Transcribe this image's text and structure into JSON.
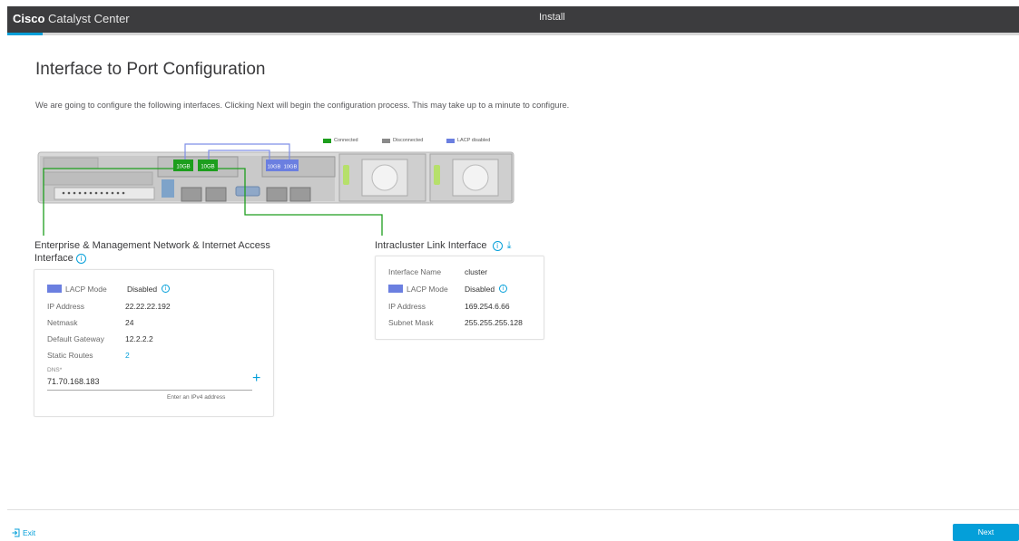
{
  "header": {
    "brand_bold": "Cisco",
    "brand_light": "Catalyst Center",
    "center_title": "Install",
    "progress_fraction": 0.035
  },
  "page": {
    "title": "Interface to Port Configuration",
    "intro": "We are going to configure the following interfaces. Clicking Next will begin the configuration process. This may take up to a minute to configure."
  },
  "legend": {
    "connected": "Connected",
    "disconnected": "Disconnected",
    "lacp_disabled": "LACP disabled",
    "colors": {
      "connected": "#1d9e1d",
      "disconnected": "#8a8a8a",
      "lacp_disabled": "#6b7fe0"
    }
  },
  "ports": {
    "p1": "10GB",
    "p2": "10GB",
    "p3": "10GB",
    "p4": "10GB"
  },
  "enterprise": {
    "title": "Enterprise & Management Network & Internet Access Interface",
    "lacp_label": "LACP Mode",
    "lacp_value": "Disabled",
    "ip_label": "IP Address",
    "ip_value": "22.22.22.192",
    "netmask_label": "Netmask",
    "netmask_value": "24",
    "gateway_label": "Default Gateway",
    "gateway_value": "12.2.2.2",
    "routes_label": "Static Routes",
    "routes_value": "2",
    "dns_label": "DNS*",
    "dns_value": "71.70.168.183",
    "dns_hint": "Enter an IPv4 address"
  },
  "intracluster": {
    "title": "Intracluster Link Interface",
    "name_label": "Interface Name",
    "name_value": "cluster",
    "lacp_label": "LACP Mode",
    "lacp_value": "Disabled",
    "ip_label": "IP Address",
    "ip_value": "169.254.6.66",
    "subnet_label": "Subnet Mask",
    "subnet_value": "255.255.255.128"
  },
  "footer": {
    "exit_label": "Exit",
    "next_label": "Next"
  },
  "colors": {
    "accent": "#049fd9",
    "topbar": "#3c3c3e",
    "connected_line": "#1d9e1d",
    "lacp_blue": "#6b7fe0"
  }
}
